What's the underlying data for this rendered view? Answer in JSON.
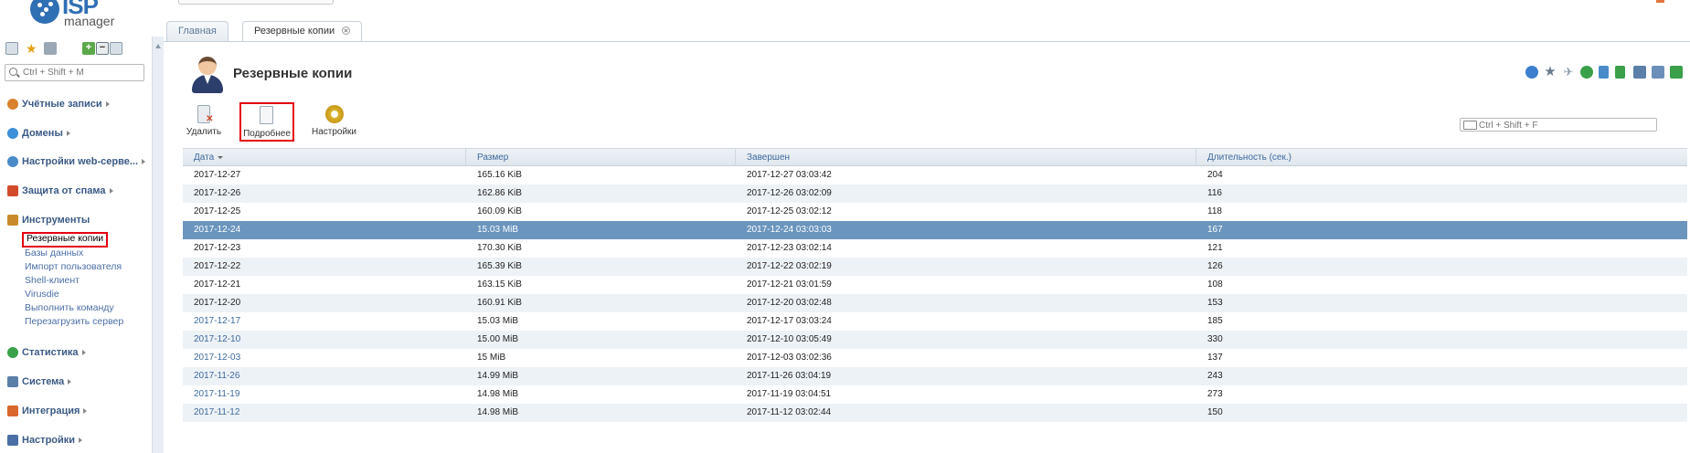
{
  "logo": {
    "brand": "ISP",
    "product": "manager"
  },
  "sidebar": {
    "search_placeholder": "Ctrl + Shift + M",
    "sections": [
      {
        "label": "Учётные записи",
        "icon": "user-accounts-icon",
        "color": "#d9822b"
      },
      {
        "label": "Домены",
        "icon": "globe-icon",
        "color": "#3c8fd8"
      },
      {
        "label": "Настройки web-серве...",
        "icon": "web-settings-icon",
        "color": "#4a8ac9"
      },
      {
        "label": "Защита от спама",
        "icon": "shield-icon",
        "color": "#d24a2b"
      },
      {
        "label": "Инструменты",
        "icon": "tools-icon",
        "color": "#c98a2b"
      },
      {
        "label": "Статистика",
        "icon": "statistics-icon",
        "color": "#3aa04a"
      },
      {
        "label": "Система",
        "icon": "system-icon",
        "color": "#5b7fa8"
      },
      {
        "label": "Интеграция",
        "icon": "integration-icon",
        "color": "#d9662b"
      },
      {
        "label": "Настройки",
        "icon": "settings-icon",
        "color": "#4a6fa5"
      }
    ],
    "tools_items": [
      "Резервные копии",
      "Базы данных",
      "Импорт пользователя",
      "Shell-клиент",
      "Virusdie",
      "Выполнить команду",
      "Перезагрузить сервер"
    ]
  },
  "tabs": [
    {
      "label": "Главная"
    },
    {
      "label": "Резервные копии"
    }
  ],
  "page": {
    "title": "Резервные копии"
  },
  "toolbar": {
    "delete_label": "Удалить",
    "details_label": "Подробнее",
    "settings_label": "Настройки",
    "search_placeholder": "Ctrl + Shift + F"
  },
  "table": {
    "columns": [
      "Дата",
      "Размер",
      "Завершен",
      "Длительность (сек.)"
    ],
    "rows": [
      {
        "date": "2017-12-27",
        "size": "165.16 KiB",
        "finished": "2017-12-27 03:03:42",
        "duration": "204",
        "link": false
      },
      {
        "date": "2017-12-26",
        "size": "162.86 KiB",
        "finished": "2017-12-26 03:02:09",
        "duration": "116",
        "link": false
      },
      {
        "date": "2017-12-25",
        "size": "160.09 KiB",
        "finished": "2017-12-25 03:02:12",
        "duration": "118",
        "link": false
      },
      {
        "date": "2017-12-24",
        "size": "15.03 MiB",
        "finished": "2017-12-24 03:03:03",
        "duration": "167",
        "link": true,
        "selected": true
      },
      {
        "date": "2017-12-23",
        "size": "170.30 KiB",
        "finished": "2017-12-23 03:02:14",
        "duration": "121",
        "link": false
      },
      {
        "date": "2017-12-22",
        "size": "165.39 KiB",
        "finished": "2017-12-22 03:02:19",
        "duration": "126",
        "link": false
      },
      {
        "date": "2017-12-21",
        "size": "163.15 KiB",
        "finished": "2017-12-21 03:01:59",
        "duration": "108",
        "link": false
      },
      {
        "date": "2017-12-20",
        "size": "160.91 KiB",
        "finished": "2017-12-20 03:02:48",
        "duration": "153",
        "link": false
      },
      {
        "date": "2017-12-17",
        "size": "15.03 MiB",
        "finished": "2017-12-17 03:03:24",
        "duration": "185",
        "link": true
      },
      {
        "date": "2017-12-10",
        "size": "15.00 MiB",
        "finished": "2017-12-10 03:05:49",
        "duration": "330",
        "link": true
      },
      {
        "date": "2017-12-03",
        "size": "15 MiB",
        "finished": "2017-12-03 03:02:36",
        "duration": "137",
        "link": true
      },
      {
        "date": "2017-11-26",
        "size": "14.99 MiB",
        "finished": "2017-11-26 03:04:19",
        "duration": "243",
        "link": true
      },
      {
        "date": "2017-11-19",
        "size": "14.98 MiB",
        "finished": "2017-11-19 03:04:51",
        "duration": "273",
        "link": true
      },
      {
        "date": "2017-11-12",
        "size": "14.98 MiB",
        "finished": "2017-11-12 03:02:44",
        "duration": "150",
        "link": true
      }
    ]
  },
  "colors": {
    "accent": "#3d6a9e",
    "selected_row": "#6b95be",
    "highlight_box": "#e3000f"
  }
}
